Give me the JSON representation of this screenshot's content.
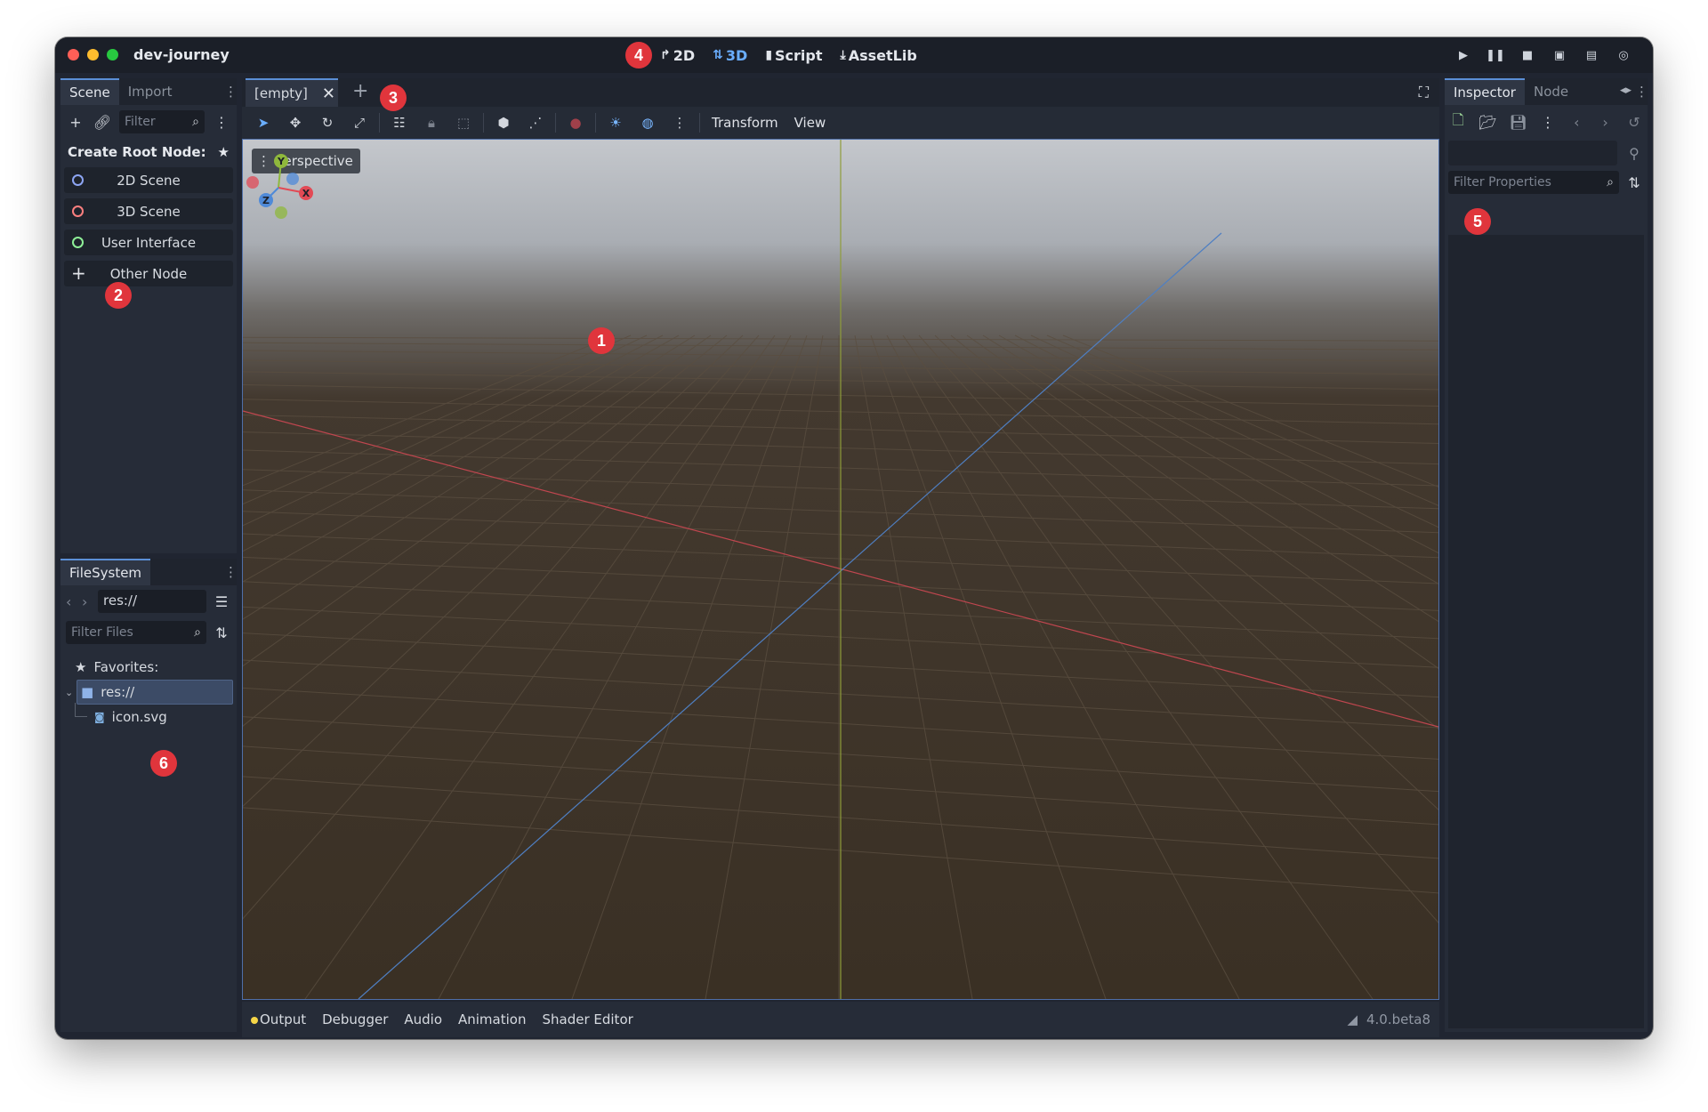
{
  "window": {
    "title": "dev-journey"
  },
  "main_tabs": [
    {
      "label": "2D",
      "icon": "2d-icon"
    },
    {
      "label": "3D",
      "icon": "3d-icon"
    },
    {
      "label": "Script",
      "icon": "script-icon"
    },
    {
      "label": "AssetLib",
      "icon": "assetlib-icon"
    }
  ],
  "run_buttons": [
    "play-icon",
    "pause-icon",
    "stop-icon",
    "play-scene-icon",
    "play-custom-scene-icon",
    "movie-maker-icon"
  ],
  "scene_dock": {
    "tabs": [
      "Scene",
      "Import"
    ],
    "filter_placeholder": "Filter",
    "create_root_label": "Create Root Node:",
    "root_options": [
      "2D Scene",
      "3D Scene",
      "User Interface",
      "Other Node"
    ]
  },
  "filesystem_dock": {
    "tab": "FileSystem",
    "path": "res://",
    "filter_placeholder": "Filter Files",
    "favorites_label": "Favorites:",
    "root_folder": "res://",
    "files": [
      "icon.svg"
    ]
  },
  "editor": {
    "scene_tab": "[empty]",
    "toolbar_menus": [
      "Transform",
      "View"
    ],
    "viewport_label": "Perspective",
    "gizmo_axes": [
      "Y",
      "X",
      "Z"
    ]
  },
  "bottom_panel": {
    "tabs": [
      "Output",
      "Debugger",
      "Audio",
      "Animation",
      "Shader Editor"
    ],
    "version": "4.0.beta8"
  },
  "inspector_dock": {
    "tabs": [
      "Inspector",
      "Node"
    ],
    "filter_placeholder": "Filter Properties"
  },
  "markers": [
    "1",
    "2",
    "3",
    "4",
    "5",
    "6"
  ],
  "colors": {
    "accent": "#5b8fd6",
    "marker": "#e0353c",
    "grid_x_axis": "#c0464f",
    "grid_z_axis": "#4f7fc2",
    "grid_y_axis": "#8f9d3a"
  }
}
